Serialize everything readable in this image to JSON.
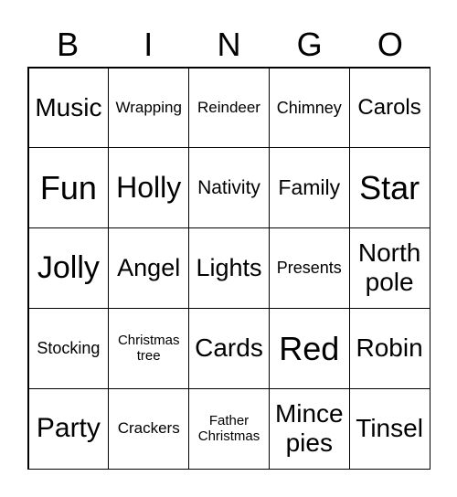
{
  "header": [
    "B",
    "I",
    "N",
    "G",
    "O"
  ],
  "cells": [
    [
      "Music",
      "Wrapping",
      "Reindeer",
      "Chimney",
      "Carols"
    ],
    [
      "Fun",
      "Holly",
      "Nativity",
      "Family",
      "Star"
    ],
    [
      "Jolly",
      "Angel",
      "Lights",
      "Presents",
      "North pole"
    ],
    [
      "Stocking",
      "Christmas tree",
      "Cards",
      "Red",
      "Robin"
    ],
    [
      "Party",
      "Crackers",
      "Father Christmas",
      "Mince pies",
      "Tinsel"
    ]
  ]
}
